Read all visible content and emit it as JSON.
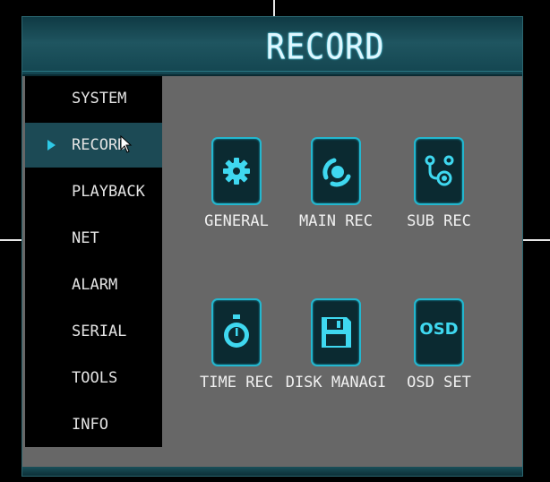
{
  "window": {
    "title": "RECORD"
  },
  "sidebar": {
    "items": [
      {
        "label": "SYSTEM",
        "active": false
      },
      {
        "label": "RECORD",
        "active": true
      },
      {
        "label": "PLAYBACK",
        "active": false
      },
      {
        "label": "NET",
        "active": false
      },
      {
        "label": "ALARM",
        "active": false
      },
      {
        "label": "SERIAL",
        "active": false
      },
      {
        "label": "TOOLS",
        "active": false
      },
      {
        "label": "INFO",
        "active": false
      }
    ]
  },
  "tiles": [
    {
      "label": "GENERAL",
      "icon": "gear-icon"
    },
    {
      "label": "MAIN REC",
      "icon": "main-rec-icon"
    },
    {
      "label": "SUB REC",
      "icon": "sub-rec-icon"
    },
    {
      "label": "TIME REC",
      "icon": "stopwatch-icon"
    },
    {
      "label": "DISK MANAGI",
      "icon": "floppy-disk-icon"
    },
    {
      "label": "OSD SET",
      "icon": "osd-icon",
      "icon_text": "OSD"
    }
  ],
  "colors": {
    "accent": "#23b7cf",
    "title_glow": "#5ee5ff",
    "active_bg": "#1c4a55",
    "panel": "#676767"
  }
}
